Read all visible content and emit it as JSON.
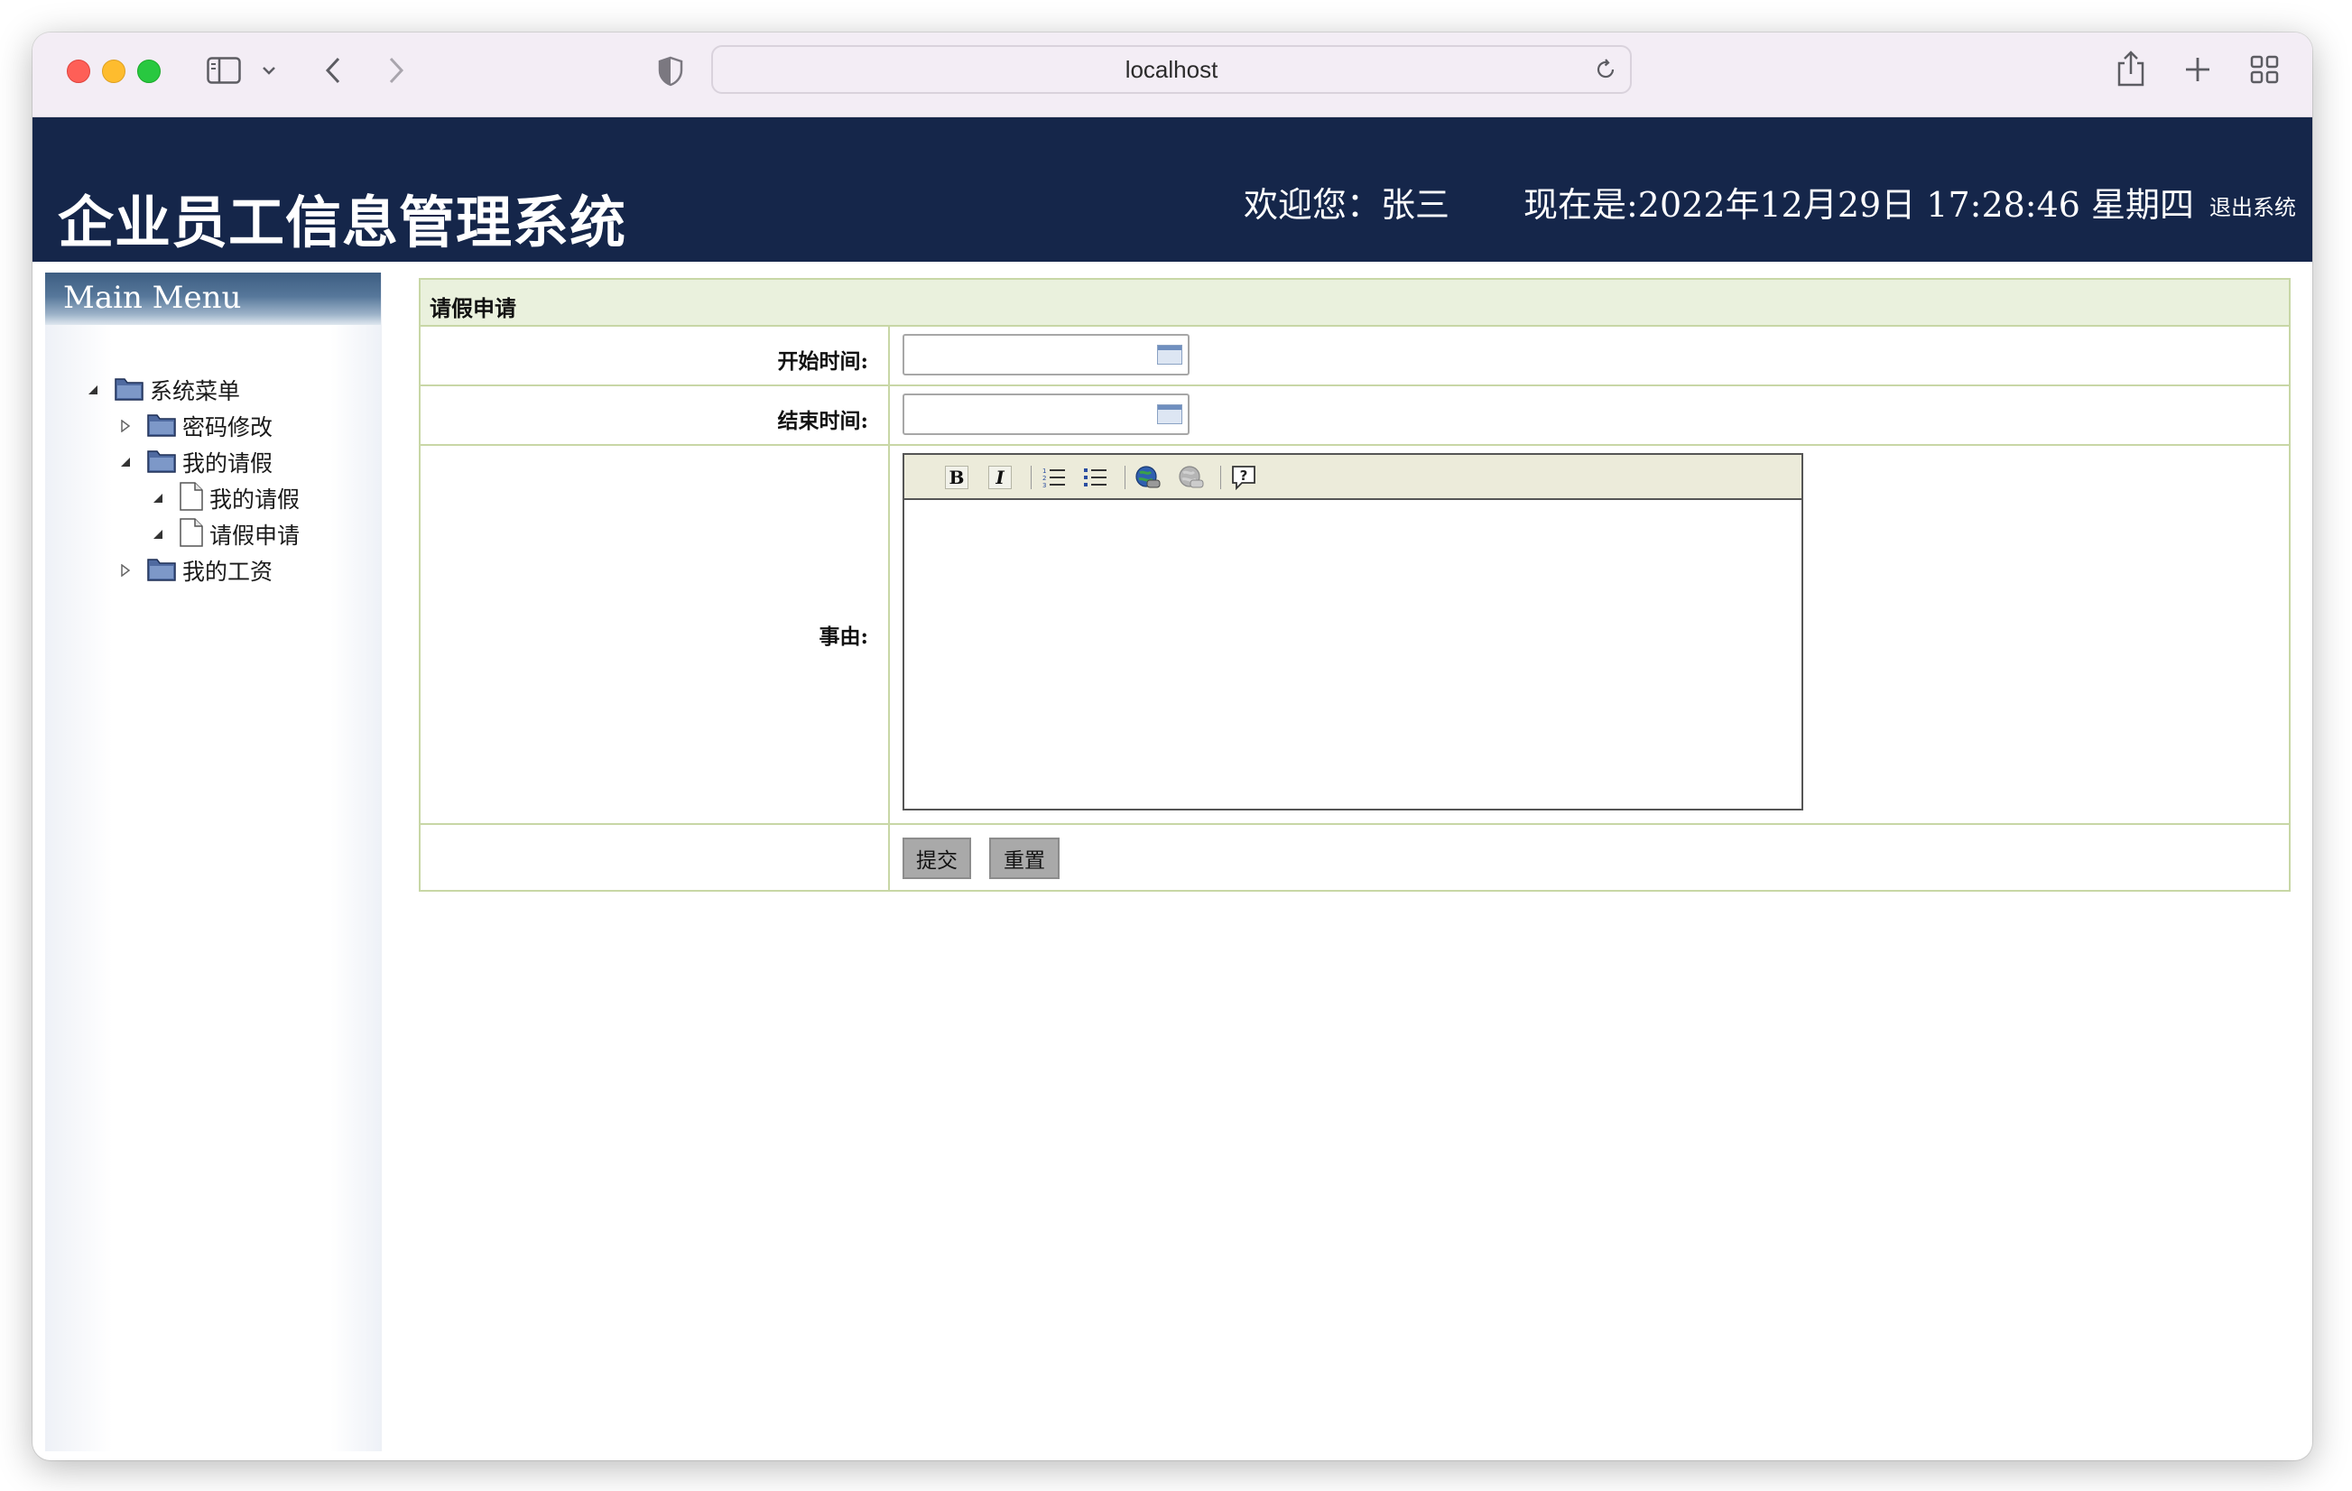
{
  "browser": {
    "url": "localhost"
  },
  "header": {
    "title": "企业员工信息管理系统",
    "welcome": "欢迎您：张三",
    "datetime": "现在是:2022年12月29日 17:28:46 星期四",
    "logout": "退出系统"
  },
  "sidebar": {
    "heading": "Main Menu",
    "tree": [
      {
        "label": "系统菜单",
        "type": "folder",
        "expanded": true,
        "level": 0
      },
      {
        "label": "密码修改",
        "type": "folder",
        "expanded": false,
        "level": 1
      },
      {
        "label": "我的请假",
        "type": "folder",
        "expanded": true,
        "level": 1
      },
      {
        "label": "我的请假",
        "type": "file",
        "level": 2
      },
      {
        "label": "请假申请",
        "type": "file",
        "level": 2
      },
      {
        "label": "我的工资",
        "type": "folder",
        "expanded": false,
        "level": 1
      }
    ]
  },
  "form": {
    "title": "请假申请",
    "start_label": "开始时间:",
    "start_value": "",
    "end_label": "结束时间:",
    "end_value": "",
    "reason_label": "事由:",
    "reason_value": "",
    "editor_tools": [
      "bold-icon",
      "italic-icon",
      "ordered-list-icon",
      "unordered-list-icon",
      "insert-link-icon",
      "remove-link-icon",
      "help-icon"
    ],
    "submit_label": "提交",
    "reset_label": "重置"
  }
}
